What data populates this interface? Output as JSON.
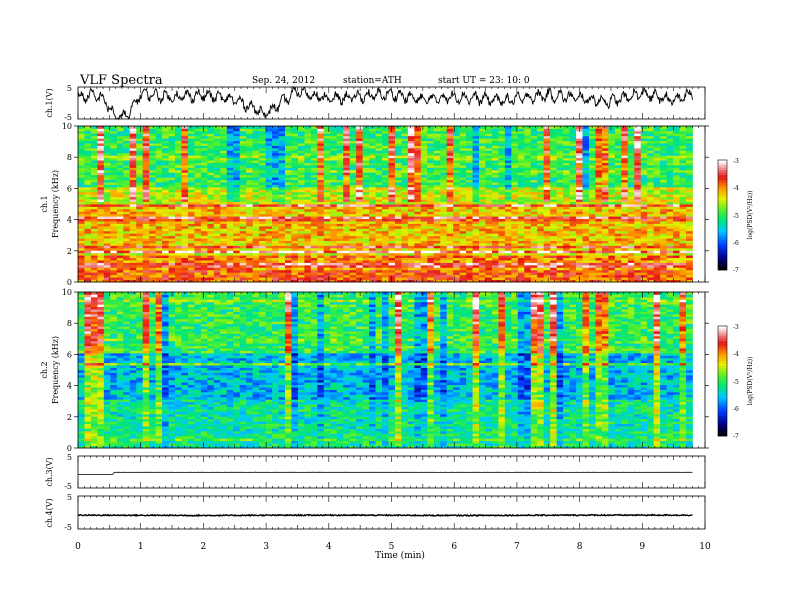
{
  "header": {
    "title": "VLF  Spectra",
    "date": "Sep. 24, 2012",
    "station": "station=ATH",
    "start": "start  UT  =   23: 10: 0"
  },
  "chart_data": {
    "type": "heatmap",
    "xlabel": "Time  (min)",
    "xlim": [
      0,
      10
    ],
    "x_ticks": [
      "0",
      "1",
      "2",
      "3",
      "4",
      "5",
      "6",
      "7",
      "8",
      "9",
      "10"
    ],
    "panels": [
      {
        "id": "ch1v",
        "type": "line",
        "ylabel": "ch.1(V)",
        "ylim": [
          -5,
          5
        ],
        "y_ticks": [
          "5",
          "-5"
        ],
        "series_points": [
          [
            0.0,
            1.5
          ],
          [
            0.2,
            2.5
          ],
          [
            0.4,
            1.5
          ],
          [
            0.5,
            -1.5
          ],
          [
            0.6,
            -4.5
          ],
          [
            0.8,
            -3.8
          ],
          [
            1.0,
            3.0
          ],
          [
            1.5,
            1.8
          ],
          [
            2.0,
            2.5
          ],
          [
            2.5,
            1.0
          ],
          [
            2.8,
            -1.5
          ],
          [
            3.0,
            -3.5
          ],
          [
            3.5,
            3.8
          ],
          [
            4.0,
            1.2
          ],
          [
            5.0,
            2.8
          ],
          [
            5.5,
            1.0
          ],
          [
            6.0,
            2.0
          ],
          [
            6.8,
            0.8
          ],
          [
            7.5,
            2.5
          ],
          [
            8.5,
            0.5
          ],
          [
            9.0,
            3.0
          ],
          [
            9.5,
            0.8
          ],
          [
            9.8,
            3.0
          ]
        ]
      },
      {
        "id": "ch1",
        "type": "spectrogram",
        "ylabel": "ch.1",
        "ylabel2": "Frequency  (kHz)",
        "ylim": [
          0,
          10
        ],
        "y_ticks": [
          "0",
          "2",
          "4",
          "6",
          "8",
          "10"
        ],
        "colorbar": {
          "label": "log(PSD(V²/Hz))",
          "range": [
            -7,
            -3
          ],
          "ticks": [
            "-3",
            "-4",
            "-5",
            "-6",
            "-7"
          ]
        },
        "data_end_min": 9.8,
        "dominant_level_by_band": [
          {
            "freq_khz": [
              0,
              1
            ],
            "log_psd": -3.8
          },
          {
            "freq_khz": [
              1,
              2
            ],
            "log_psd": -4.0
          },
          {
            "freq_khz": [
              2,
              5
            ],
            "log_psd": -4.2
          },
          {
            "freq_khz": [
              5,
              6
            ],
            "log_psd": -4.5
          },
          {
            "freq_khz": [
              6,
              10
            ],
            "log_psd": -5.0
          }
        ]
      },
      {
        "id": "ch2",
        "type": "spectrogram",
        "ylabel": "ch.2",
        "ylabel2": "Frequency  (kHz)",
        "ylim": [
          0,
          10
        ],
        "y_ticks": [
          "0",
          "2",
          "4",
          "6",
          "8",
          "10"
        ],
        "colorbar": {
          "label": "log(PSD(V²/Hz))",
          "range": [
            -7,
            -3
          ],
          "ticks": [
            "-3",
            "-4",
            "-5",
            "-6",
            "-7"
          ]
        },
        "data_end_min": 9.8,
        "dominant_level_by_band": [
          {
            "freq_khz": [
              0,
              1
            ],
            "log_psd": -5.2
          },
          {
            "freq_khz": [
              1,
              3
            ],
            "log_psd": -5.3
          },
          {
            "freq_khz": [
              3,
              6
            ],
            "log_psd": -5.6
          },
          {
            "freq_khz": [
              6,
              10
            ],
            "log_psd": -5.0
          }
        ]
      },
      {
        "id": "ch3v",
        "type": "line",
        "ylabel": "ch.3(V)",
        "ylim": [
          -5,
          5
        ],
        "y_ticks": [
          "5",
          "-5"
        ],
        "series_points": [
          [
            0.0,
            -0.8
          ],
          [
            0.55,
            -0.8
          ],
          [
            0.58,
            -0.1
          ],
          [
            9.8,
            -0.1
          ]
        ]
      },
      {
        "id": "ch4v",
        "type": "line",
        "ylabel": "ch.4(V)",
        "ylim": [
          -5,
          5
        ],
        "y_ticks": [
          "5",
          "-5"
        ],
        "series_points": [
          [
            0.0,
            -0.8
          ],
          [
            2.0,
            -0.9
          ],
          [
            4.0,
            -0.8
          ],
          [
            6.0,
            -0.9
          ],
          [
            8.0,
            -0.8
          ],
          [
            9.8,
            -0.8
          ]
        ]
      }
    ]
  }
}
